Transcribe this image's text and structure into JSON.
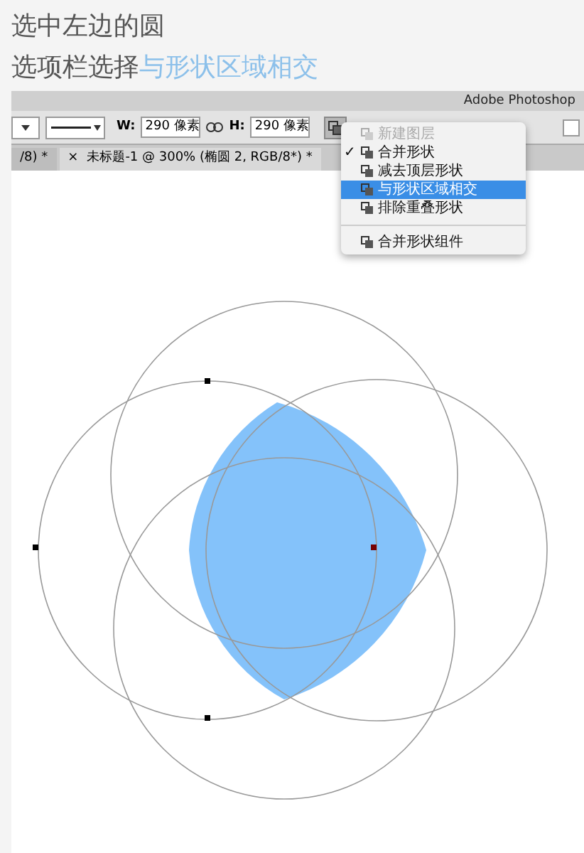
{
  "heading": "选中左边的圆",
  "instruction": {
    "text": "选项栏选择",
    "highlight": "与形状区域相交"
  },
  "app_title": "Adobe Photoshop",
  "toolbar": {
    "width_label": "W:",
    "width_value": "290 像素",
    "height_label": "H:",
    "height_value": "290 像素",
    "checkbox_checked": false
  },
  "tabs": [
    {
      "label": "/8) *",
      "selected": false
    },
    {
      "close": "×",
      "label": "未标题-1 @ 300% (椭圆 2, RGB/8*) *",
      "selected": true
    }
  ],
  "menu": [
    {
      "label": "新建图层",
      "checked": false,
      "selected": false,
      "disabled": true
    },
    {
      "label": "合并形状",
      "checked": true,
      "selected": false,
      "disabled": false
    },
    {
      "label": "减去顶层形状",
      "checked": false,
      "selected": false,
      "disabled": false
    },
    {
      "label": "与形状区域相交",
      "checked": false,
      "selected": true,
      "disabled": false
    },
    {
      "label": "排除重叠形状",
      "checked": false,
      "selected": false,
      "disabled": false
    },
    {
      "label": "合并形状组件",
      "checked": false,
      "selected": false,
      "disabled": false
    }
  ],
  "check_mark": "✓"
}
